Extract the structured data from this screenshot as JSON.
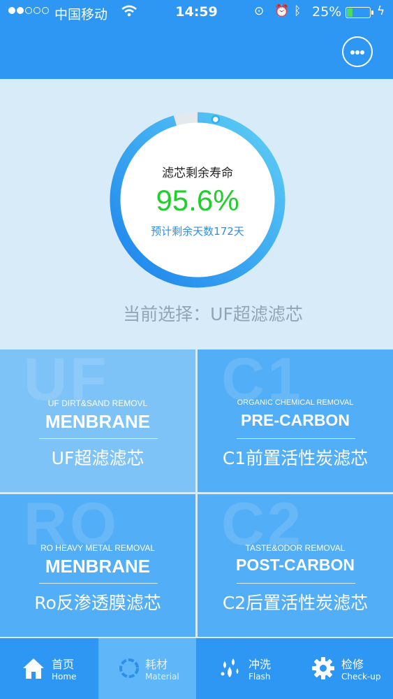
{
  "status_bar": {
    "carrier": "中国移动",
    "time": "14:59",
    "battery_percent": "25%",
    "battery_level": 0.25,
    "icons": [
      "signal-dots",
      "wifi-icon",
      "rotation-lock-icon",
      "alarm-icon",
      "bluetooth-icon",
      "battery-icon",
      "charging-icon"
    ]
  },
  "header": {
    "more_icon": "more-dots-icon"
  },
  "gauge": {
    "title": "滤芯剩余寿命",
    "percent_text": "95.6%",
    "percent_value": 95.6,
    "days_text": "预计剩余天数172天",
    "colors": {
      "arc_start": "#1b82ec",
      "arc_end": "#5fd0f6",
      "track": "#e4e9ee",
      "percent": "#1fcf2b"
    }
  },
  "current_selection": "当前选择：UF超滤滤芯",
  "tiles": [
    {
      "watermark": "UF",
      "subtitle": "UF DIRT&SAND REMOVL",
      "title": "MENBRANE",
      "name": "UF超滤滤芯",
      "selected": true
    },
    {
      "watermark": "C1",
      "subtitle": "ORGANIC CHEMICAL REMOVAL",
      "title": "PRE-CARBON",
      "name": "C1前置活性炭滤芯",
      "selected": false
    },
    {
      "watermark": "RO",
      "subtitle": "RO HEAVY METAL REMOVAL",
      "title": "MENBRANE",
      "name": "Ro反渗透膜滤芯",
      "selected": false
    },
    {
      "watermark": "C2",
      "subtitle": "TASTE&ODOR REMOVAL",
      "title": "POST-CARBON",
      "name": "C2后置活性炭滤芯",
      "selected": false
    }
  ],
  "nav": [
    {
      "label": "首页",
      "sublabel": "Home",
      "icon": "home-icon",
      "active": false
    },
    {
      "label": "耗材",
      "sublabel": "Material",
      "icon": "ring-icon",
      "active": true
    },
    {
      "label": "冲洗",
      "sublabel": "Flash",
      "icon": "water-splash-icon",
      "active": false
    },
    {
      "label": "检修",
      "sublabel": "Check-up",
      "icon": "gear-icon",
      "active": false
    }
  ]
}
